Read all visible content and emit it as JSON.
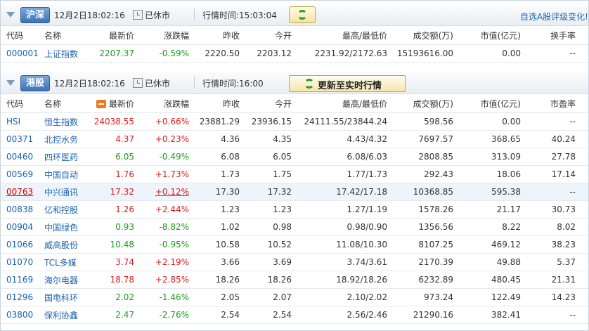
{
  "top_link": "自选A股评级变化!",
  "sections": [
    {
      "tag": "沪深",
      "time": "12月2日18:02:16",
      "status": "已休市",
      "trade_time": "行情时间:15:03:04",
      "headers": [
        "代码",
        "名称",
        "最新价",
        "涨跌幅",
        "昨收",
        "今开",
        "最高/最低价",
        "成交额(万)",
        "市值(亿元)",
        "换手率"
      ],
      "rows": [
        {
          "code": "000001",
          "name": "上证指数",
          "price": "2207.37",
          "change": "-0.59%",
          "trend": "dn",
          "prev": "2220.50",
          "open": "2203.12",
          "hl": "2231.92/2172.63",
          "amount": "15193616.00",
          "cap": "0.00",
          "extra": "--"
        }
      ]
    },
    {
      "tag": "港股",
      "time": "12月2日18:02:16",
      "status": "已休市",
      "trade_time": "行情时间:16:00",
      "refresh_label": "更新至实时行情",
      "headers": [
        "代码",
        "名称",
        "最新价",
        "涨跌幅",
        "昨收",
        "今开",
        "最高/最低价",
        "成交额(万)",
        "市值(亿元)",
        "市盈率"
      ],
      "rows": [
        {
          "code": "HSI",
          "name": "恒生指数",
          "price": "24038.55",
          "change": "+0.66%",
          "trend": "up",
          "prev": "23881.29",
          "open": "23936.15",
          "hl": "24111.55/23844.24",
          "amount": "598.56",
          "cap": "0.00",
          "extra": "--"
        },
        {
          "code": "00371",
          "name": "北控水务",
          "price": "4.37",
          "change": "+0.23%",
          "trend": "up",
          "prev": "4.36",
          "open": "4.35",
          "hl": "4.43/4.32",
          "amount": "7697.57",
          "cap": "368.65",
          "extra": "40.24"
        },
        {
          "code": "00460",
          "name": "四环医药",
          "price": "6.05",
          "change": "-0.49%",
          "trend": "dn",
          "prev": "6.08",
          "open": "6.05",
          "hl": "6.08/6.03",
          "amount": "2808.85",
          "cap": "313.09",
          "extra": "27.78"
        },
        {
          "code": "00569",
          "name": "中国自动",
          "price": "1.76",
          "change": "+1.73%",
          "trend": "up",
          "prev": "1.73",
          "open": "1.75",
          "hl": "1.77/1.73",
          "amount": "292.43",
          "cap": "18.06",
          "extra": "17.14"
        },
        {
          "code": "00763",
          "name": "中兴通讯",
          "price": "17.32",
          "change": "+0.12%",
          "trend": "up",
          "prev": "17.30",
          "open": "17.32",
          "hl": "17.42/17.18",
          "amount": "10368.85",
          "cap": "595.38",
          "extra": "--",
          "selected": true
        },
        {
          "code": "00838",
          "name": "亿和控股",
          "price": "1.26",
          "change": "+2.44%",
          "trend": "up",
          "prev": "1.23",
          "open": "1.23",
          "hl": "1.27/1.19",
          "amount": "1578.26",
          "cap": "21.17",
          "extra": "30.73"
        },
        {
          "code": "00904",
          "name": "中国绿色",
          "price": "0.93",
          "change": "-8.82%",
          "trend": "dn",
          "prev": "1.02",
          "open": "0.98",
          "hl": "0.98/0.90",
          "amount": "1356.56",
          "cap": "8.22",
          "extra": "8.02"
        },
        {
          "code": "01066",
          "name": "威高股份",
          "price": "10.48",
          "change": "-0.95%",
          "trend": "dn",
          "prev": "10.58",
          "open": "10.52",
          "hl": "11.08/10.30",
          "amount": "8107.25",
          "cap": "469.12",
          "extra": "38.23"
        },
        {
          "code": "01070",
          "name": "TCL多媒",
          "price": "3.74",
          "change": "+2.19%",
          "trend": "up",
          "prev": "3.66",
          "open": "3.69",
          "hl": "3.74/3.61",
          "amount": "2170.39",
          "cap": "49.88",
          "extra": "5.37"
        },
        {
          "code": "01169",
          "name": "海尔电器",
          "price": "18.78",
          "change": "+2.85%",
          "trend": "up",
          "prev": "18.26",
          "open": "18.26",
          "hl": "18.92/18.26",
          "amount": "6232.89",
          "cap": "480.45",
          "extra": "21.31"
        },
        {
          "code": "01296",
          "name": "国电科环",
          "price": "2.02",
          "change": "-1.46%",
          "trend": "dn",
          "prev": "2.05",
          "open": "2.07",
          "hl": "2.10/2.02",
          "amount": "973.24",
          "cap": "122.49",
          "extra": "14.23"
        },
        {
          "code": "03800",
          "name": "保利协鑫",
          "price": "2.47",
          "change": "-2.76%",
          "trend": "dn",
          "prev": "2.54",
          "open": "2.54",
          "hl": "2.56/2.46",
          "amount": "21290.16",
          "cap": "382.41",
          "extra": "--"
        }
      ]
    }
  ],
  "colors": {
    "up": "#e21b1b",
    "down": "#1d9a1d",
    "link": "#1a62b0",
    "tag": "#3d73b5"
  },
  "icons": [
    "collapse-triangle-icon",
    "clock-icon",
    "refresh-icon",
    "sort-icon"
  ]
}
